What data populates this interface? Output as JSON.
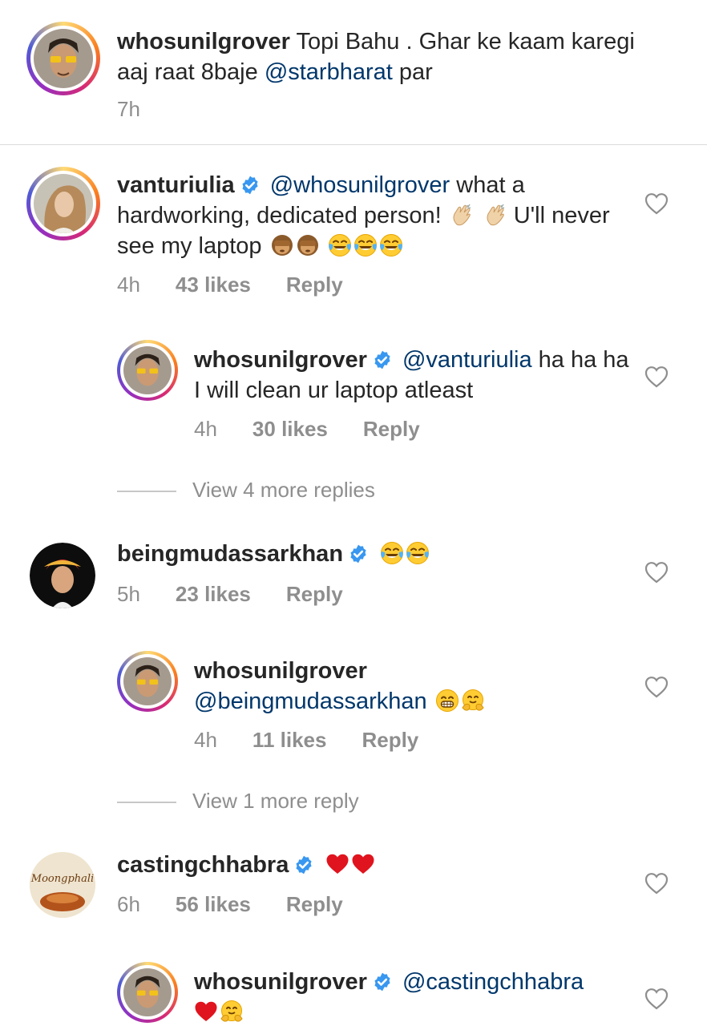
{
  "caption": {
    "username": "whosunilgrover",
    "text_part1": " Topi Bahu . Ghar ke kaam karegi aaj raat 8baje ",
    "mention": "@starbharat",
    "text_part2": " par",
    "time": "7h"
  },
  "comments": [
    {
      "username": "vanturiulia",
      "mention": "@whosunilgrover",
      "text": " what a hardworking, dedicated person!",
      "text_after_emoji": " U'll never see my laptop ",
      "time": "4h",
      "likes": "43 likes",
      "reply_label": "Reply"
    },
    {
      "username": "whosunilgrover",
      "mention": "@vanturiulia",
      "text": " ha ha ha I will clean ur laptop atleast",
      "time": "4h",
      "likes": "30 likes",
      "reply_label": "Reply"
    },
    {
      "username": "beingmudassarkhan",
      "time": "5h",
      "likes": "23 likes",
      "reply_label": "Reply"
    },
    {
      "username": "whosunilgrover",
      "mention": "@beingmudassarkhan",
      "time": "4h",
      "likes": "11 likes",
      "reply_label": "Reply"
    },
    {
      "username": "castingchhabra",
      "avatar_logo_text": "Moongphali",
      "time": "6h",
      "likes": "56 likes",
      "reply_label": "Reply"
    },
    {
      "username": "whosunilgrover",
      "mention": "@castingchhabra"
    }
  ],
  "view_more": [
    "View 4 more replies",
    "View 1 more reply"
  ],
  "icons": {
    "verified": "verified-badge-icon",
    "heart": "heart-outline-icon",
    "emoji_clap": "clapping-hands-emoji",
    "emoji_monkey": "see-no-evil-monkey-emoji",
    "emoji_joy": "tears-of-joy-emoji",
    "emoji_grin": "grinning-face-emoji",
    "emoji_hug": "hugging-face-emoji",
    "emoji_heart": "red-heart-emoji"
  },
  "colors": {
    "mention": "#00376b",
    "meta": "#8e8e8e",
    "verified": "#3897f0",
    "divider": "#dbdbdb"
  }
}
